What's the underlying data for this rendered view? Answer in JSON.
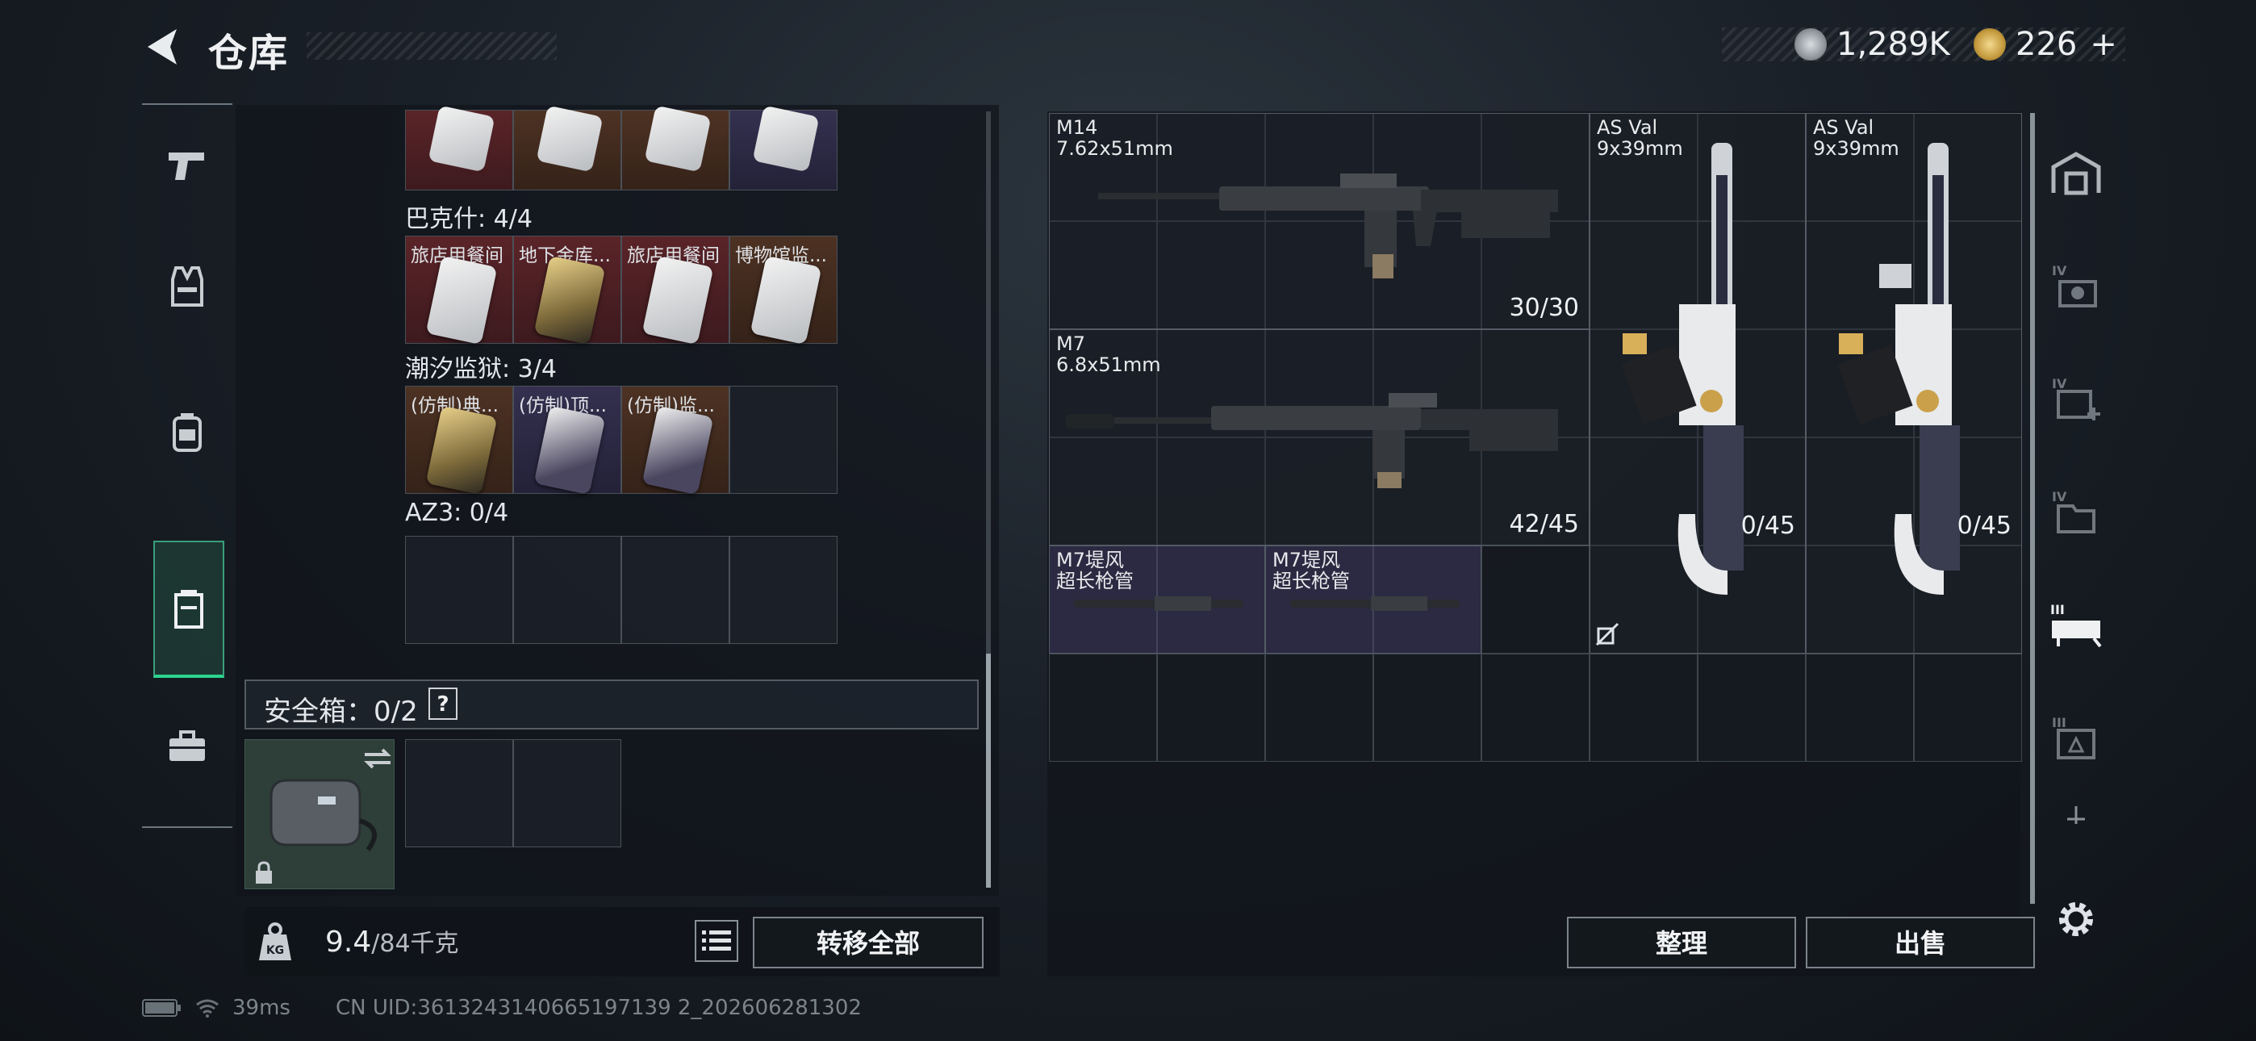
{
  "header": {
    "title": "仓库",
    "currency": [
      {
        "icon": "silver-coin-icon",
        "value": "1,289K"
      },
      {
        "icon": "gold-triangle-coin-icon",
        "value": "226"
      }
    ],
    "add_label": "+"
  },
  "left_nav": [
    "pistol-icon",
    "vest-icon",
    "backpack-icon",
    "chest-rig-icon",
    "toolbox-icon"
  ],
  "storage": {
    "sections": [
      {
        "title": "",
        "cards": [
          "",
          "",
          "",
          ""
        ]
      },
      {
        "title": "巴克什: 4/4",
        "cards": [
          "旅店用餐间",
          "地下金库...",
          "旅店用餐间",
          "博物馆监..."
        ]
      },
      {
        "title": "潮汐监狱: 3/4",
        "cards": [
          "(仿制)典...",
          "(仿制)顶...",
          "(仿制)监..."
        ]
      },
      {
        "title": "AZ3: 0/4",
        "cards": []
      }
    ],
    "safe_box": {
      "label": "安全箱：0/2",
      "help": "?"
    },
    "weight": {
      "value": "9.4",
      "max": "/84千克"
    },
    "transfer_all": "转移全部"
  },
  "weapons": [
    {
      "name": "M14",
      "caliber": "7.62x51mm",
      "ammo": "30/30"
    },
    {
      "name": "M7",
      "caliber": "6.8x51mm",
      "ammo": "42/45"
    },
    {
      "name": "AS Val",
      "caliber": "9x39mm",
      "ammo": "0/45"
    },
    {
      "name": "AS Val",
      "caliber": "9x39mm",
      "ammo": "0/45"
    },
    {
      "name": "M7堤风",
      "caliber": "超长枪管",
      "ammo": ""
    },
    {
      "name": "M7堤风",
      "caliber": "超长枪管",
      "ammo": ""
    }
  ],
  "right_nav": [
    "home-icon",
    "iv-case-icon",
    "iv-medical-icon",
    "iv-folder-icon",
    "iii-weapon-case-icon",
    "iii-case-icon",
    "plus-icon"
  ],
  "actions": {
    "sort": "整理",
    "sell": "出售"
  },
  "status": {
    "ping": "39ms",
    "uid": "CN UID:3613243140665197139 2_202606281302"
  },
  "colors": {
    "accent_green": "#2bd48f",
    "red_card": "#5a2428",
    "purple_card": "#34304f"
  }
}
